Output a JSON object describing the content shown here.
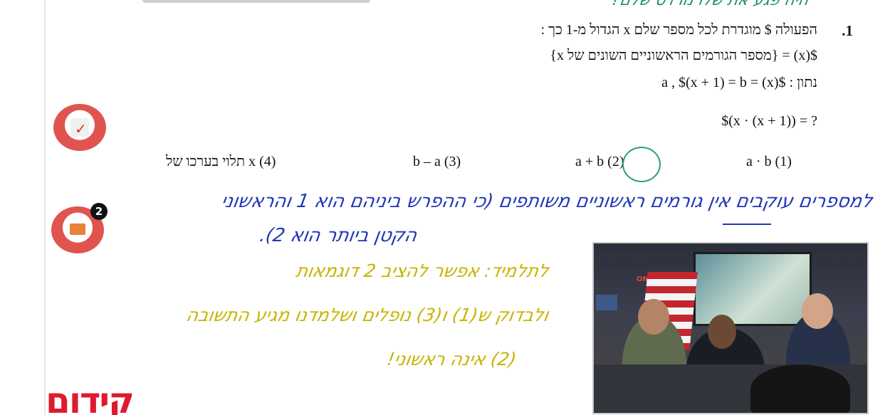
{
  "question": {
    "number": ".1",
    "line1": "הפעולה $ מוגדרת לכל מספר שלם x הגדול מ-1 כך :",
    "line2": "$(x) = {מספר הגורמים הראשוניים השונים של x}",
    "line3": "נתון :  $(x) = a  ,  $(x + 1) = b",
    "line4": "$(x · (x + 1)) = ?"
  },
  "options": [
    {
      "label": "a · b   (1)"
    },
    {
      "label": "a + b   (2)"
    },
    {
      "label": "b – a   (3)"
    },
    {
      "label": "תלוי בערכו של x   (4)"
    }
  ],
  "handwriting": {
    "green": "היה פגע את שלו נורדס שלם?",
    "blue_line1": "למספרים עוקבים אין גורמים ראשוניים משותפים (כי ההפרש ביניהם הוא 1 והראשוני",
    "blue_line2": "הקטן ביותר הוא 2).",
    "yellow_line1": "לתלמיד: אפשר להציב 2 דוגמאות",
    "yellow_line2": "ולבדוק ש(1) ו(3) נופלים ושלמדנו מגיע התשובה",
    "yellow_line3": "(2) אינה ראשוני!"
  },
  "badges": {
    "notification_count": "2"
  },
  "photo": {
    "sign_text": "ON AIR"
  },
  "logo": {
    "text": "קידום"
  },
  "colors": {
    "handwriting_green": "#1f8f63",
    "handwriting_blue": "#2237b8",
    "handwriting_yellow": "#c9b400",
    "logo_red": "#e01a2d",
    "circle": "#2e9c80"
  }
}
